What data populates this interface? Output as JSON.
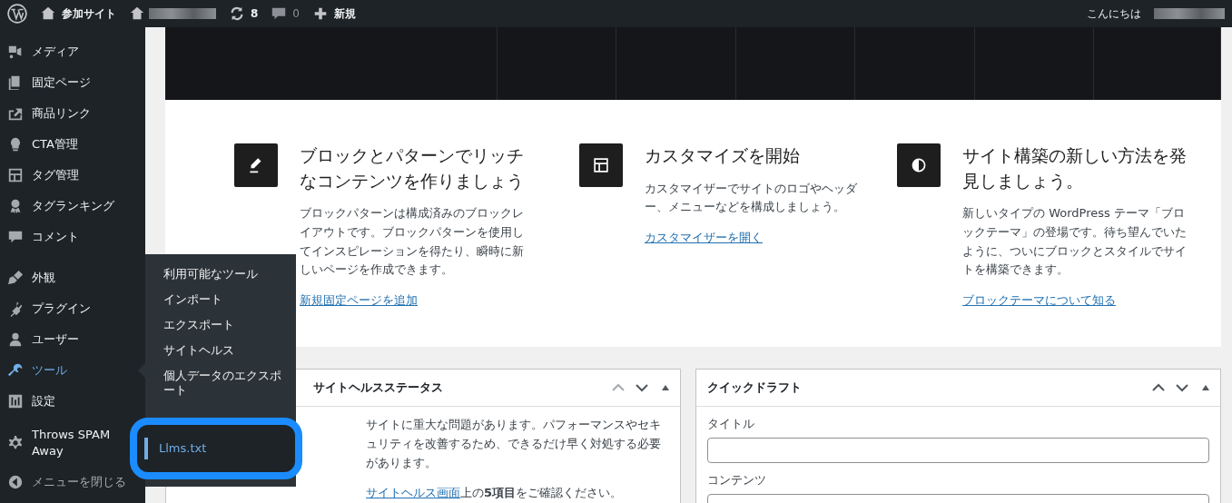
{
  "admin_bar": {
    "my_sites": "参加サイト",
    "updates": "8",
    "comments": "0",
    "new": "新規",
    "greeting": "こんにちは"
  },
  "sidebar": {
    "items": [
      {
        "label": "メディア",
        "selected": false
      },
      {
        "label": "固定ページ",
        "selected": false
      },
      {
        "label": "商品リンク",
        "selected": false
      },
      {
        "label": "CTA管理",
        "selected": false
      },
      {
        "label": "タグ管理",
        "selected": false
      },
      {
        "label": "タグランキング",
        "selected": false
      },
      {
        "label": "コメント",
        "selected": false
      },
      {
        "label": "外観",
        "selected": false
      },
      {
        "label": "プラグイン",
        "selected": false
      },
      {
        "label": "ユーザー",
        "selected": false
      },
      {
        "label": "ツール",
        "selected": true
      },
      {
        "label": "設定",
        "selected": false
      },
      {
        "label": "Throws SPAM Away",
        "selected": false
      }
    ],
    "collapse": "メニューを閉じる"
  },
  "submenu": {
    "items": [
      {
        "label": "利用可能なツール",
        "selected": false
      },
      {
        "label": "インポート",
        "selected": false
      },
      {
        "label": "エクスポート",
        "selected": false
      },
      {
        "label": "サイトヘルス",
        "selected": false
      },
      {
        "label": "個人データのエクスポート",
        "selected": false
      },
      {
        "label": "Llms.txt",
        "selected": true
      }
    ]
  },
  "welcome": {
    "cards": [
      {
        "title": "ブロックとパターンでリッチなコンテンツを作りましょう",
        "body": "ブロックパターンは構成済みのブロックレイアウトです。ブロックパターンを使用してインスピレーションを得たり、瞬時に新しいページを作成できます。",
        "link": "新規固定ページを追加"
      },
      {
        "title": "カスタマイズを開始",
        "body": "カスタマイザーでサイトのロゴやヘッダー、メニューなどを構成しましょう。",
        "link": "カスタマイザーを開く"
      },
      {
        "title": "サイト構築の新しい方法を発見しましょう。",
        "body": "新しいタイプの WordPress テーマ「ブロックテーマ」の登場です。待ち望んでいたように、ついにブロックとスタイルでサイトを構築できます。",
        "link": "ブロックテーマについて知る"
      }
    ]
  },
  "site_health": {
    "title": "サイトヘルスステータス",
    "message": "サイトに重大な問題があります。パフォーマンスやセキュリティを改善するため、できるだけ早く対処する必要があります。",
    "detail_link": "サイトヘルス画面",
    "detail": "上の**5項目**をご確認ください。"
  },
  "quick_draft": {
    "title": "クイックドラフト",
    "title_label": "タイトル",
    "content_label": "コンテンツ"
  }
}
